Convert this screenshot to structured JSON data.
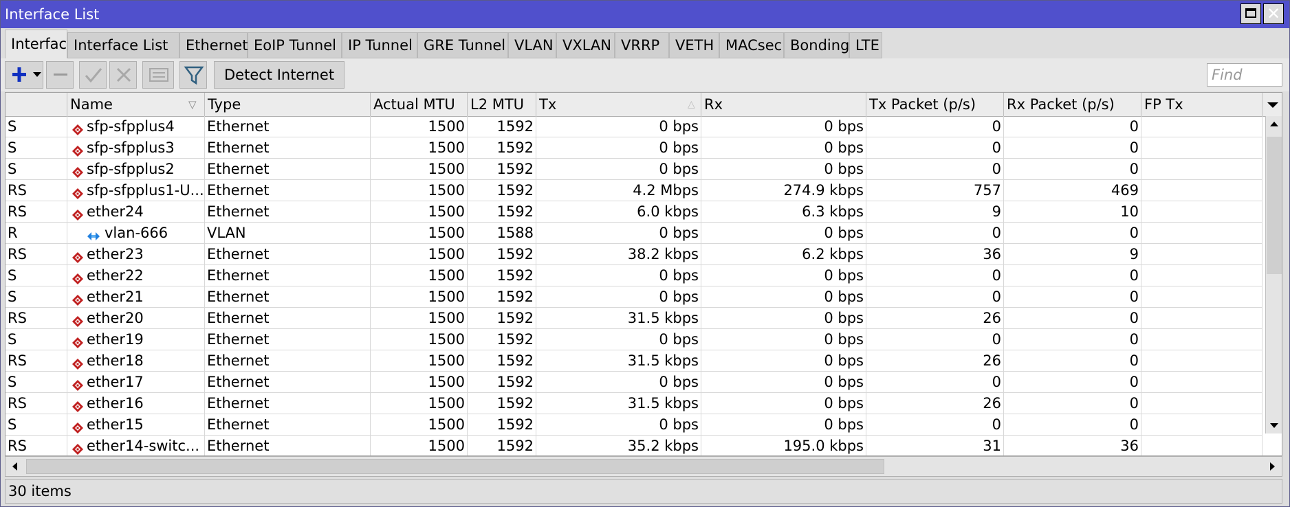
{
  "window": {
    "title": "Interface List"
  },
  "tabs": [
    {
      "label": "Interface",
      "active": true
    },
    {
      "label": "Interface List"
    },
    {
      "label": "Ethernet"
    },
    {
      "label": "EoIP Tunnel"
    },
    {
      "label": "IP Tunnel"
    },
    {
      "label": "GRE Tunnel"
    },
    {
      "label": "VLAN"
    },
    {
      "label": "VXLAN"
    },
    {
      "label": "VRRP"
    },
    {
      "label": "VETH"
    },
    {
      "label": "MACsec"
    },
    {
      "label": "Bonding"
    },
    {
      "label": "LTE"
    }
  ],
  "toolbar": {
    "detect_label": "Detect Internet",
    "find_placeholder": "Find"
  },
  "columns": [
    "",
    "Name",
    "Type",
    "Actual MTU",
    "L2 MTU",
    "Tx",
    "Rx",
    "Tx Packet (p/s)",
    "Rx Packet (p/s)",
    "FP Tx"
  ],
  "rows": [
    {
      "flags": "S",
      "name": "sfp-sfpplus4",
      "kind": "ethernet",
      "type": "Ethernet",
      "mtu": "1500",
      "l2mtu": "1592",
      "tx": "0 bps",
      "rx": "0 bps",
      "txp": "0",
      "rxp": "0",
      "fptx": ""
    },
    {
      "flags": "S",
      "name": "sfp-sfpplus3",
      "kind": "ethernet",
      "type": "Ethernet",
      "mtu": "1500",
      "l2mtu": "1592",
      "tx": "0 bps",
      "rx": "0 bps",
      "txp": "0",
      "rxp": "0",
      "fptx": ""
    },
    {
      "flags": "S",
      "name": "sfp-sfpplus2",
      "kind": "ethernet",
      "type": "Ethernet",
      "mtu": "1500",
      "l2mtu": "1592",
      "tx": "0 bps",
      "rx": "0 bps",
      "txp": "0",
      "rxp": "0",
      "fptx": ""
    },
    {
      "flags": "RS",
      "name": "sfp-sfpplus1-U...",
      "kind": "ethernet",
      "type": "Ethernet",
      "mtu": "1500",
      "l2mtu": "1592",
      "tx": "4.2 Mbps",
      "rx": "274.9 kbps",
      "txp": "757",
      "rxp": "469",
      "fptx": ""
    },
    {
      "flags": "RS",
      "name": "ether24",
      "kind": "ethernet",
      "type": "Ethernet",
      "mtu": "1500",
      "l2mtu": "1592",
      "tx": "6.0 kbps",
      "rx": "6.3 kbps",
      "txp": "9",
      "rxp": "10",
      "fptx": ""
    },
    {
      "flags": "R",
      "name": "vlan-666",
      "kind": "vlan",
      "type": "VLAN",
      "mtu": "1500",
      "l2mtu": "1588",
      "tx": "0 bps",
      "rx": "0 bps",
      "txp": "0",
      "rxp": "0",
      "fptx": ""
    },
    {
      "flags": "RS",
      "name": "ether23",
      "kind": "ethernet",
      "type": "Ethernet",
      "mtu": "1500",
      "l2mtu": "1592",
      "tx": "38.2 kbps",
      "rx": "6.2 kbps",
      "txp": "36",
      "rxp": "9",
      "fptx": ""
    },
    {
      "flags": "S",
      "name": "ether22",
      "kind": "ethernet",
      "type": "Ethernet",
      "mtu": "1500",
      "l2mtu": "1592",
      "tx": "0 bps",
      "rx": "0 bps",
      "txp": "0",
      "rxp": "0",
      "fptx": ""
    },
    {
      "flags": "S",
      "name": "ether21",
      "kind": "ethernet",
      "type": "Ethernet",
      "mtu": "1500",
      "l2mtu": "1592",
      "tx": "0 bps",
      "rx": "0 bps",
      "txp": "0",
      "rxp": "0",
      "fptx": ""
    },
    {
      "flags": "RS",
      "name": "ether20",
      "kind": "ethernet",
      "type": "Ethernet",
      "mtu": "1500",
      "l2mtu": "1592",
      "tx": "31.5 kbps",
      "rx": "0 bps",
      "txp": "26",
      "rxp": "0",
      "fptx": ""
    },
    {
      "flags": "S",
      "name": "ether19",
      "kind": "ethernet",
      "type": "Ethernet",
      "mtu": "1500",
      "l2mtu": "1592",
      "tx": "0 bps",
      "rx": "0 bps",
      "txp": "0",
      "rxp": "0",
      "fptx": ""
    },
    {
      "flags": "RS",
      "name": "ether18",
      "kind": "ethernet",
      "type": "Ethernet",
      "mtu": "1500",
      "l2mtu": "1592",
      "tx": "31.5 kbps",
      "rx": "0 bps",
      "txp": "26",
      "rxp": "0",
      "fptx": ""
    },
    {
      "flags": "S",
      "name": "ether17",
      "kind": "ethernet",
      "type": "Ethernet",
      "mtu": "1500",
      "l2mtu": "1592",
      "tx": "0 bps",
      "rx": "0 bps",
      "txp": "0",
      "rxp": "0",
      "fptx": ""
    },
    {
      "flags": "RS",
      "name": "ether16",
      "kind": "ethernet",
      "type": "Ethernet",
      "mtu": "1500",
      "l2mtu": "1592",
      "tx": "31.5 kbps",
      "rx": "0 bps",
      "txp": "26",
      "rxp": "0",
      "fptx": ""
    },
    {
      "flags": "S",
      "name": "ether15",
      "kind": "ethernet",
      "type": "Ethernet",
      "mtu": "1500",
      "l2mtu": "1592",
      "tx": "0 bps",
      "rx": "0 bps",
      "txp": "0",
      "rxp": "0",
      "fptx": ""
    },
    {
      "flags": "RS",
      "name": "ether14-switc...",
      "kind": "ethernet",
      "type": "Ethernet",
      "mtu": "1500",
      "l2mtu": "1592",
      "tx": "35.2 kbps",
      "rx": "195.0 kbps",
      "txp": "31",
      "rxp": "36",
      "fptx": ""
    }
  ],
  "status": {
    "items": "30 items"
  },
  "icons": {
    "ethernet": "ethernet-port-icon",
    "vlan": "vlan-icon",
    "add": "plus-icon",
    "remove": "minus-icon",
    "enable": "check-icon",
    "disable": "x-icon",
    "comment": "comment-icon",
    "filter": "filter-icon"
  },
  "colors": {
    "titlebar": "#5050cc",
    "ethernet_icon": "#c02020",
    "vlan_icon": "#2080e0",
    "add_icon": "#1030c0"
  }
}
